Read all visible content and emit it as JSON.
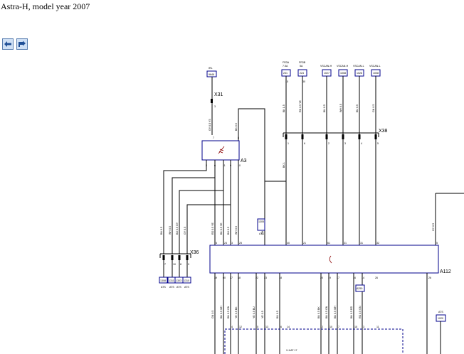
{
  "page": {
    "title": "Astra-H, model year 2007"
  },
  "nav": {
    "back_icon": "arrow-left-icon",
    "forward_icon": "arrow-forward-icon"
  },
  "colors": {
    "wire": "#000000",
    "component": "#00008b",
    "nav_bg": "#cfe0f5"
  },
  "diagram": {
    "connectors": {
      "x31": "X31",
      "x31_pin": "3",
      "x36": "X36",
      "x36_pins": [
        "7",
        "10",
        "8",
        "9"
      ],
      "x38": "X38",
      "x38_pins": [
        "1",
        "6",
        "2",
        "3",
        "4",
        "5"
      ]
    },
    "components": {
      "a3": "A3",
      "a112": "A112"
    },
    "top_labels": {
      "irl": "IRL",
      "irl_box": "9646",
      "fs1_name": "FR3A",
      "fs1_rating": "7.5A",
      "fs1_box": "231",
      "fs1_pin": "15",
      "fs2_name": "FR3B",
      "fs2_rating": "5A",
      "fs2_box": "224",
      "fs2_pin": "30",
      "vscan1": "VSCAN-H",
      "vscan1_box": "1027",
      "vscan2": "VSCAN-H",
      "vscan2_box": "1008",
      "vscan3": "VSCAN-L",
      "vscan3_box": "1026",
      "vscan4": "VSCAN-L",
      "vscan4_box": "1008"
    },
    "a3_pins_top": [
      "7",
      "8"
    ],
    "a3_pins_bottom": [
      "2",
      "6",
      "11",
      "9",
      "10"
    ],
    "a112_pins_top": [
      "6",
      "24",
      "3",
      "25",
      "40",
      "21",
      "61",
      "31",
      "31",
      "32",
      "5"
    ],
    "a112_pins_bottom": [
      "39",
      "60",
      "37",
      "38",
      "22",
      "23",
      "18",
      "20",
      "19",
      "17",
      "16",
      "14",
      "26"
    ],
    "wires_top": [
      "GY 0.5 Y5",
      "BK 0.5",
      "BK 1.5",
      "RD 0.5 YE",
      "BU 0.5",
      "WH 0.5",
      "BU 0.5",
      "GN 0.5"
    ],
    "wires_mid": [
      "BK 1",
      "BN 0.5",
      "WH 0.5",
      "BU 0.5 GY",
      "GY 0.5",
      "RD 0.5 YE",
      "BK 0.5 YE",
      "BU 0.5",
      "WH 0.5",
      "GN 0.5",
      "GY 0.5"
    ],
    "x36_boxes": [
      "1308",
      "1311",
      "1303",
      "1310"
    ],
    "x36_box_labels": [
      "ATS",
      "ATS",
      "ATS",
      "ATS"
    ],
    "ats_box": "1305",
    "ats_label": "ATS",
    "a112_bottom_boxes": {
      "box1": "A250",
      "ats_right": "ATS",
      "ats_right_box": "1020"
    },
    "wires_bottom": [
      "GN 0.5",
      "BN 0.5 WH",
      "BN 0.5 GN",
      "YE 0.5 BK",
      "YE 0.5 BU",
      "YE 0.5",
      "BU 0.5",
      "BN 0.5 BK",
      "BN 0.5 GN",
      "BN 0.5 WH",
      "BN 0.5 RD",
      "RD 0.5 GN"
    ],
    "bottom_connector_pins": [
      "4",
      "12",
      "5",
      "13",
      "6",
      "14",
      "2",
      "10",
      "7",
      "15",
      "3",
      "11"
    ],
    "bottom_labels": {
      "ref": "X-HAT 17"
    }
  }
}
